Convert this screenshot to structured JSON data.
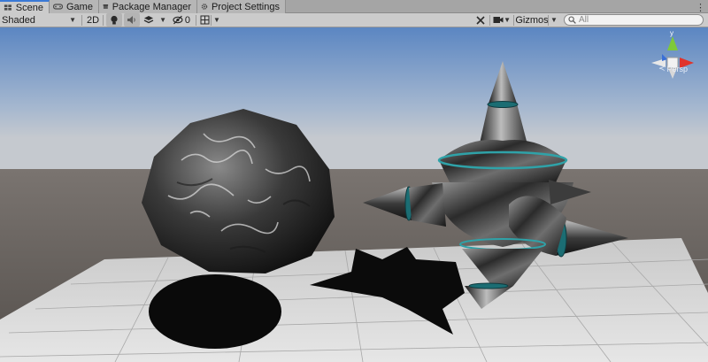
{
  "tabs": [
    {
      "label": "Scene",
      "icon": "scene-icon",
      "active": true
    },
    {
      "label": "Game",
      "icon": "game-icon",
      "active": false
    },
    {
      "label": "Package Manager",
      "icon": "package-icon",
      "active": false
    },
    {
      "label": "Project Settings",
      "icon": "gear-icon",
      "active": false
    }
  ],
  "tab_menu": "⋮",
  "toolbar": {
    "shading_mode": "Shaded",
    "mode_2d": "2D",
    "hidden_count": "0",
    "gizmos_label": "Gizmos",
    "search_placeholder": "All"
  },
  "orientation_gizmo": {
    "y_label": "y",
    "projection_label": "Persp"
  },
  "colors": {
    "accent": "#3a79d6",
    "axis_x": "#e0332b",
    "axis_y": "#7ec93a",
    "axis_z": "#3a6fd6"
  }
}
